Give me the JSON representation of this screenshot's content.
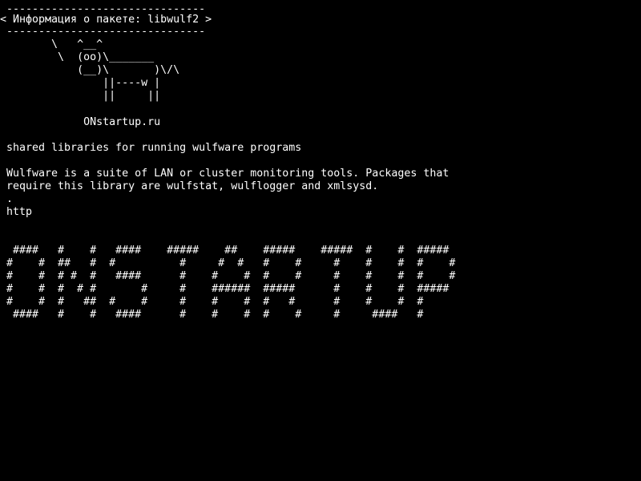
{
  "colors": {
    "background": "#000000",
    "foreground": "#ffffff"
  },
  "terminal": {
    "banner": {
      "rule_top": " -------------------------------",
      "title": "< Информация о пакете: libwulf2 >",
      "rule_bottom": " -------------------------------"
    },
    "cow": {
      "line1": "        \\   ^__^",
      "line2": "         \\  (oo)\\_______",
      "line3": "            (__)\\       )\\/\\",
      "line4": "                ||----w |",
      "line5": "                ||     ||"
    },
    "site": "             ONstartup.ru",
    "summary": "shared libraries for running wulfware programs",
    "description": {
      "line1": "Wulfware is a suite of LAN or cluster monitoring tools. Packages that",
      "line2": "require this library are wulfstat, wulflogger and xmlsysd.",
      "line3": ".",
      "line4": "http"
    },
    "big_text": {
      "line1": " ####   #    #   ####    #####    ##    #####    #####  #    #  #####",
      "line2": "#    #  ##   #  #          #     #  #   #    #     #    #    #  #    #",
      "line3": "#    #  # #  #   ####      #    #    #  #    #     #    #    #  #    #",
      "line4": "#    #  #  # #       #     #    ######  #####      #    #    #  #####",
      "line5": "#    #  #   ##  #    #     #    #    #  #   #      #    #    #  #",
      "line6": " ####   #    #   ####      #    #    #  #    #     #     ####   #"
    }
  }
}
